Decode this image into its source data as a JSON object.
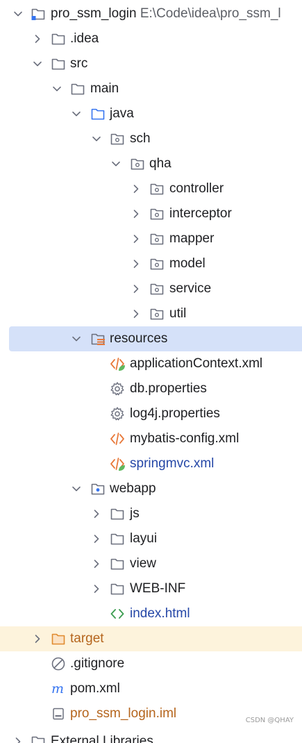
{
  "project": {
    "name": "pro_ssm_login",
    "path": "E:\\Code\\idea\\pro_ssm_l"
  },
  "tree": {
    "idea": ".idea",
    "src": "src",
    "main": "main",
    "java": "java",
    "sch": "sch",
    "qha": "qha",
    "controller": "controller",
    "interceptor": "interceptor",
    "mapper": "mapper",
    "model": "model",
    "service": "service",
    "util": "util",
    "resources": "resources",
    "applicationContext": "applicationContext.xml",
    "db_properties": "db.properties",
    "log4j_properties": "log4j.properties",
    "mybatis_config": "mybatis-config.xml",
    "springmvc": "springmvc.xml",
    "webapp": "webapp",
    "js": "js",
    "layui": "layui",
    "view": "view",
    "web_inf": "WEB-INF",
    "index_html": "index.html",
    "target": "target",
    "gitignore": ".gitignore",
    "pom": "pom.xml",
    "iml": "pro_ssm_login.iml",
    "external_libraries": "External Libraries"
  },
  "colors": {
    "selection": "#d5e1f9",
    "excluded": "#fdf3dc",
    "modified_file": "#2547a7",
    "excluded_text": "#b5651d",
    "xml_icon": "#e8793a"
  },
  "watermark": "CSDN @QHAY"
}
